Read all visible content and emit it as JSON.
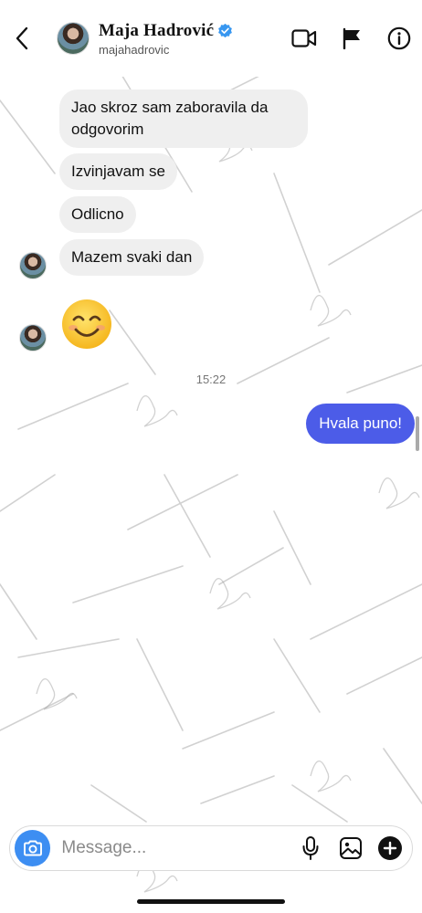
{
  "header": {
    "contact_name": "Maja Hadrović",
    "username": "majahadrovic",
    "icons": [
      "back-chevron-icon",
      "verified-badge-icon",
      "video-call-icon",
      "flag-icon",
      "info-icon"
    ]
  },
  "messages": [
    {
      "direction": "incoming",
      "text": "Jao skroz sam zaboravila da odgovorim"
    },
    {
      "direction": "incoming",
      "text": "Izvinjavam se"
    },
    {
      "direction": "incoming",
      "text": "Odlicno"
    },
    {
      "direction": "incoming",
      "text": "Mazem svaki dan"
    },
    {
      "direction": "incoming",
      "type": "emoji",
      "emoji": "smiling-face-with-smiling-eyes"
    },
    {
      "type": "timestamp",
      "text": "15:22"
    },
    {
      "direction": "outgoing",
      "text": "Hvala puno!"
    }
  ],
  "composer": {
    "placeholder": "Message...",
    "icons": [
      "camera-icon",
      "microphone-icon",
      "gallery-icon",
      "plus-icon"
    ]
  },
  "colors": {
    "outgoing_bubble": "#4c5ce8",
    "incoming_bubble": "#efefef",
    "camera_button": "#3d8ef2",
    "verified_badge": "#3897f0"
  }
}
